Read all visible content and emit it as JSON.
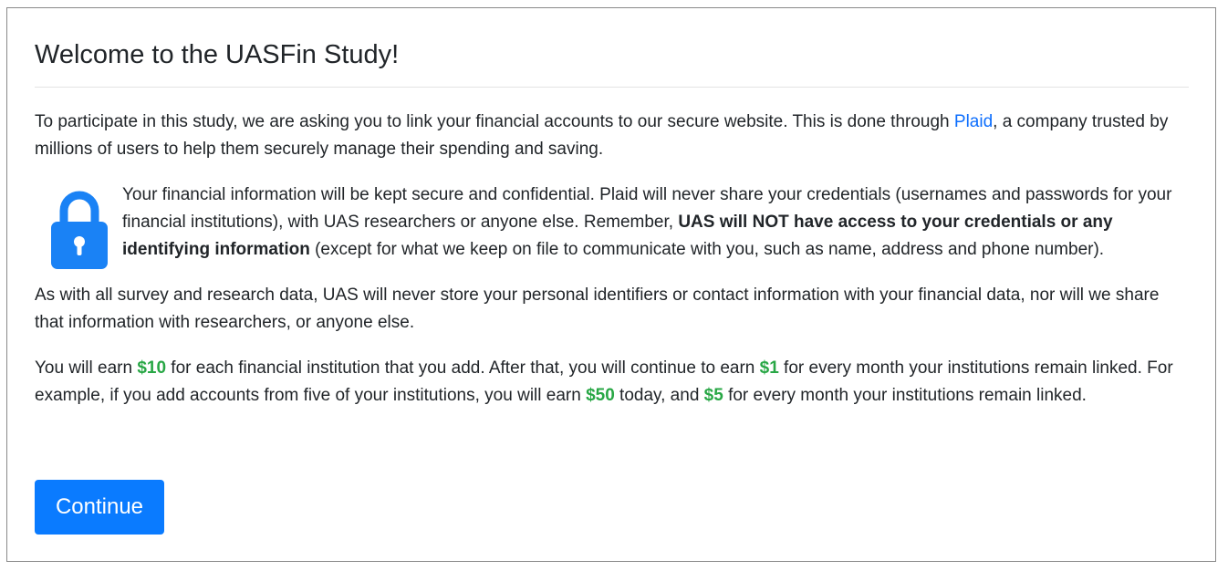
{
  "page": {
    "title": "Welcome to the UASFin Study!"
  },
  "intro": {
    "before_link": "To participate in this study, we are asking you to link your financial accounts to our secure website. This is done through ",
    "link_text": "Plaid",
    "after_link": ", a company trusted by millions of users to help them securely manage their spending and saving."
  },
  "security": {
    "icon": "lock-icon",
    "text_1": "Your financial information will be kept secure and confidential. Plaid will never share your credentials (usernames and passwords for your financial institutions), with UAS researchers or anyone else. Remember, ",
    "bold": "UAS will NOT have access to your credentials or any identifying information",
    "text_2": " (except for what we keep on file to communicate with you, such as name, address and phone number)."
  },
  "privacy": {
    "text": "As with all survey and research data, UAS will never store your personal identifiers or contact information with your financial data, nor will we share that information with researchers, or anyone else."
  },
  "earnings": {
    "t1": "You will earn ",
    "amount_per_institution": "$10",
    "t2": " for each financial institution that you add. After that, you will continue to earn ",
    "amount_per_month": "$1",
    "t3": " for every month your institutions remain linked. For example, if you add accounts from five of your institutions, you will earn ",
    "amount_example_today": "$50",
    "t4": " today, and ",
    "amount_example_month": "$5",
    "t5": " for every month your institutions remain linked."
  },
  "actions": {
    "continue_label": "Continue"
  },
  "colors": {
    "accent": "#0a7bff",
    "link": "#0d6efd",
    "money": "#28a745",
    "lock": "#1a82f5"
  }
}
